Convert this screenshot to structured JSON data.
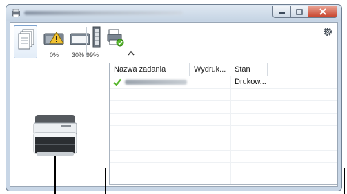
{
  "window": {
    "title": ""
  },
  "toolbar": {
    "gauges": [
      {
        "id": "toner-1",
        "value": "0%"
      },
      {
        "id": "toner-2",
        "value": "30%"
      },
      {
        "id": "paper",
        "value": "99%"
      }
    ]
  },
  "jobs": {
    "columns": [
      "Nazwa zadania",
      "Wydruk...",
      "Stan",
      ""
    ],
    "rows": [
      {
        "name": "",
        "printed": "",
        "status": "Drukow..."
      }
    ]
  },
  "colors": {
    "accent": "#7da2ce",
    "check": "#55b52a"
  }
}
